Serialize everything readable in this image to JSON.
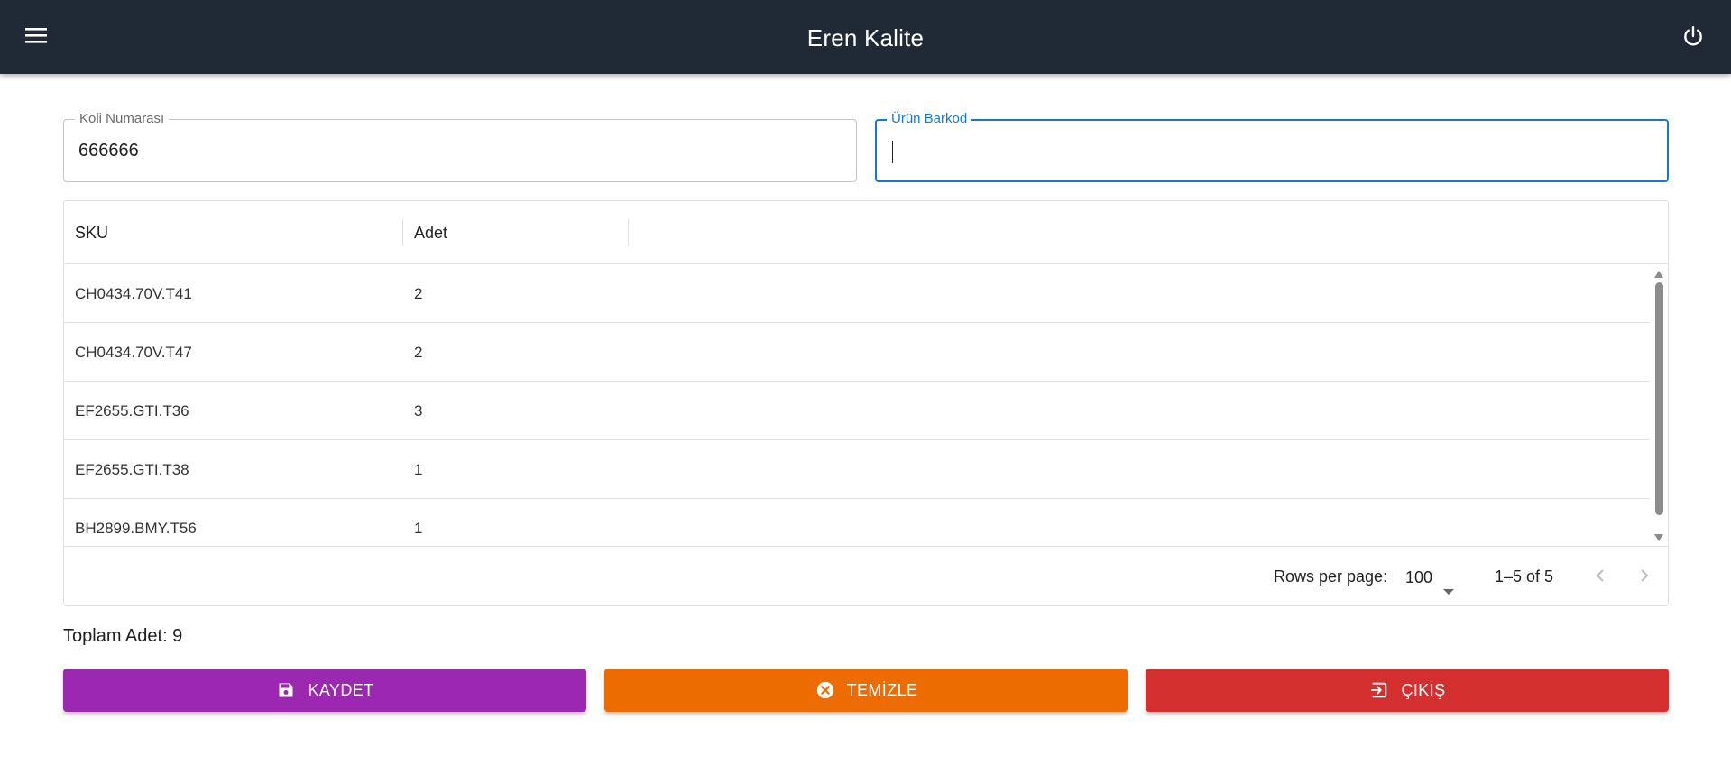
{
  "header": {
    "title": "Eren Kalite",
    "menu_icon": "menu-icon",
    "power_icon": "power-icon"
  },
  "form": {
    "koli": {
      "label": "Koli Numarası",
      "value": "666666"
    },
    "barkod": {
      "label": "Ürün Barkod",
      "value": ""
    }
  },
  "table": {
    "columns": {
      "sku": "SKU",
      "adet": "Adet"
    },
    "rows": [
      {
        "sku": "CH0434.70V.T41",
        "adet": "2"
      },
      {
        "sku": "CH0434.70V.T47",
        "adet": "2"
      },
      {
        "sku": "EF2655.GTI.T36",
        "adet": "3"
      },
      {
        "sku": "EF2655.GTI.T38",
        "adet": "1"
      },
      {
        "sku": "BH2899.BMY.T56",
        "adet": "1"
      }
    ],
    "footer": {
      "rows_per_page_label": "Rows per page:",
      "rows_per_page_value": "100",
      "page_info": "1–5 of 5"
    }
  },
  "summary": {
    "total_text": "Toplam Adet: 9"
  },
  "actions": {
    "save": {
      "label": "KAYDET",
      "icon": "save-icon",
      "color": "#9c27b0"
    },
    "clear": {
      "label": "TEMİZLE",
      "icon": "cancel-icon",
      "color": "#ed6c02"
    },
    "exit": {
      "label": "ÇIKIŞ",
      "icon": "exit-icon",
      "color": "#d32f2f"
    }
  },
  "colors": {
    "appbar": "#1f2a36",
    "focus": "#1976d2"
  }
}
